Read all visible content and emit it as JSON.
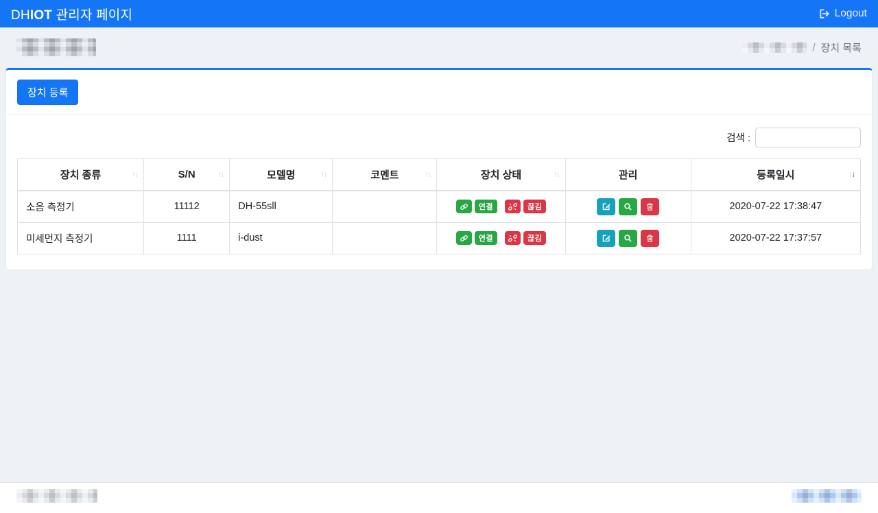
{
  "topbar": {
    "brand_regular": "DH",
    "brand_bold": "IOT",
    "brand_rest": " 관리자 페이지",
    "logout_label": "Logout"
  },
  "page": {
    "breadcrumb_separator": "/",
    "breadcrumb_current": "장치 목록"
  },
  "card": {
    "register_button_label": "장치 등록"
  },
  "search": {
    "label": "검색 :",
    "value": "",
    "placeholder": ""
  },
  "table": {
    "columns": [
      {
        "label": "장치 종류",
        "sortable": true,
        "sort": "none"
      },
      {
        "label": "S/N",
        "sortable": true,
        "sort": "none"
      },
      {
        "label": "모델명",
        "sortable": true,
        "sort": "none"
      },
      {
        "label": "코멘트",
        "sortable": true,
        "sort": "none"
      },
      {
        "label": "장치 상태",
        "sortable": true,
        "sort": "none"
      },
      {
        "label": "관리",
        "sortable": false,
        "sort": "none"
      },
      {
        "label": "등록일시",
        "sortable": true,
        "sort": "desc"
      }
    ],
    "status": {
      "connected_label": "연결",
      "disconnected_label": "끊김"
    },
    "rows": [
      {
        "device_type": "소음 측정기",
        "serial": "11112",
        "model": "DH-55sll",
        "comment": "",
        "registered_at": "2020-07-22 17:38:47"
      },
      {
        "device_type": "미세먼지 측정기",
        "serial": "1111",
        "model": "i-dust",
        "comment": "",
        "registered_at": "2020-07-22 17:37:57"
      }
    ]
  },
  "colors": {
    "primary_blue": "#1476f6",
    "success_green": "#28a745",
    "danger_red": "#dc3545",
    "info_teal": "#17a2b8",
    "page_background": "#eef1f6"
  }
}
